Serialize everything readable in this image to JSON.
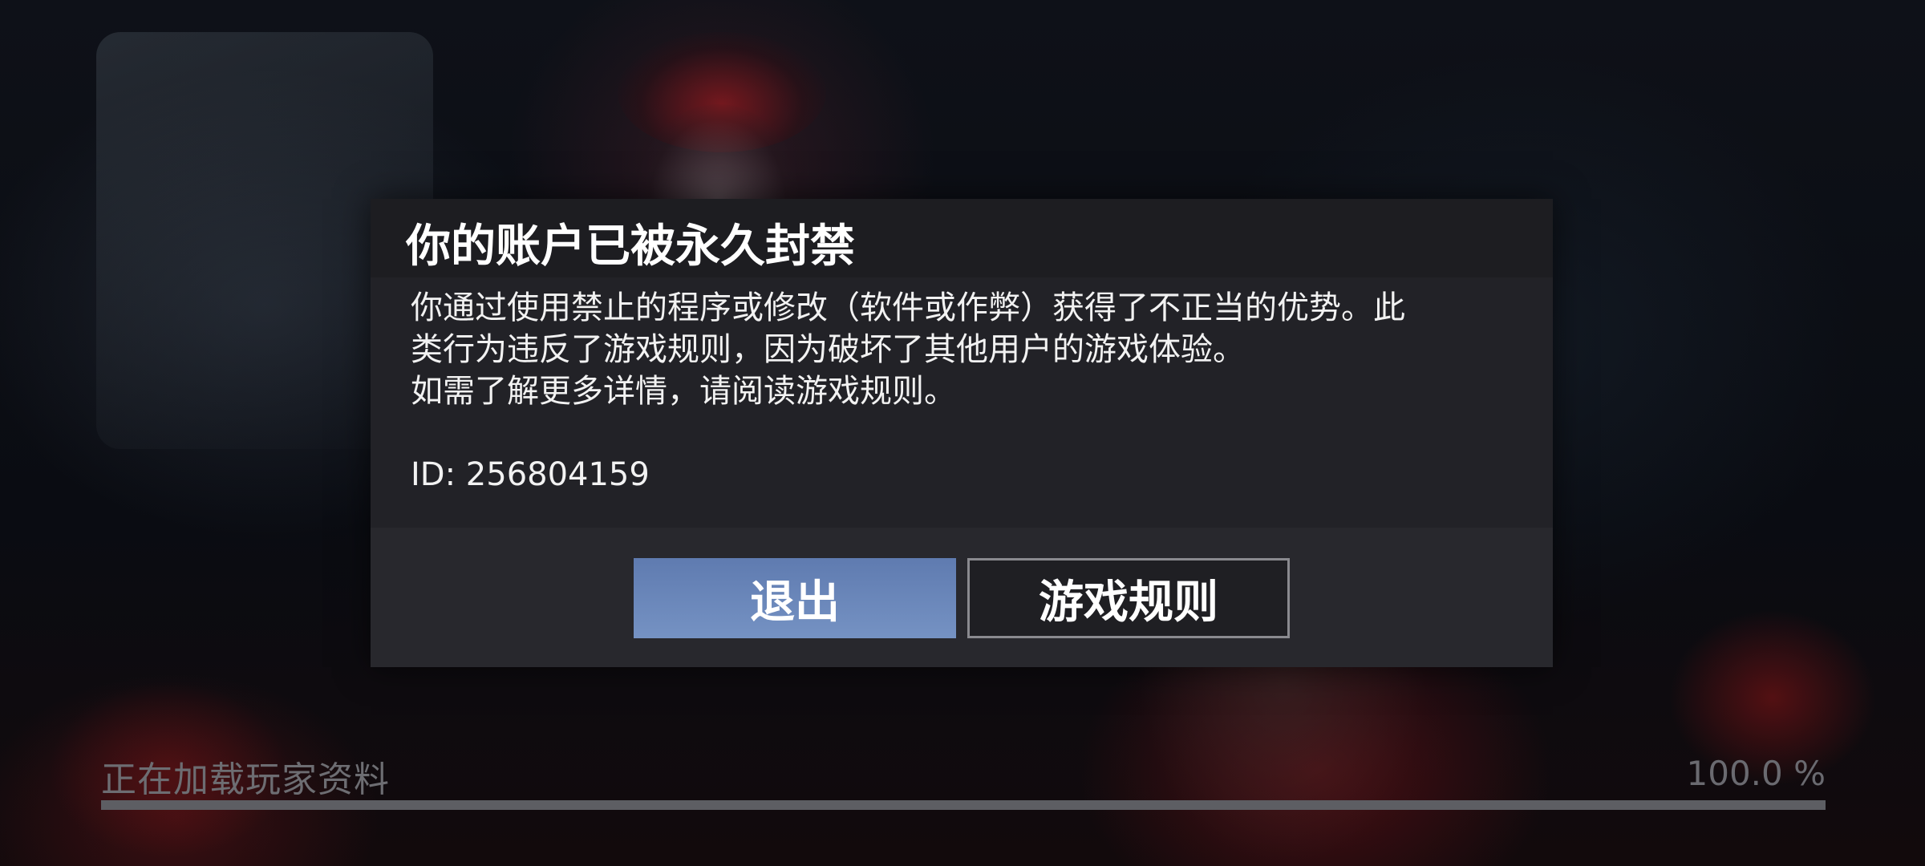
{
  "dialog": {
    "title": "你的账户已被永久封禁",
    "message_lines": [
      "你通过使用禁止的程序或修改（软件或作弊）获得了不正当的优势。此",
      "类行为违反了游戏规则，因为破坏了其他用户的游戏体验。",
      "如需了解更多详情，请阅读游戏规则。"
    ],
    "account_id": "ID: 256804159",
    "buttons": {
      "exit_label": "退出",
      "rules_label": "游戏规则"
    }
  },
  "loading": {
    "label": "正在加载玩家资料",
    "percent_text": "100.0 %",
    "progress_fraction": 1.0
  },
  "colors": {
    "exit_button": "#6a86ba",
    "dialog_bg": "#222227",
    "header_bg": "#1d1d21"
  }
}
